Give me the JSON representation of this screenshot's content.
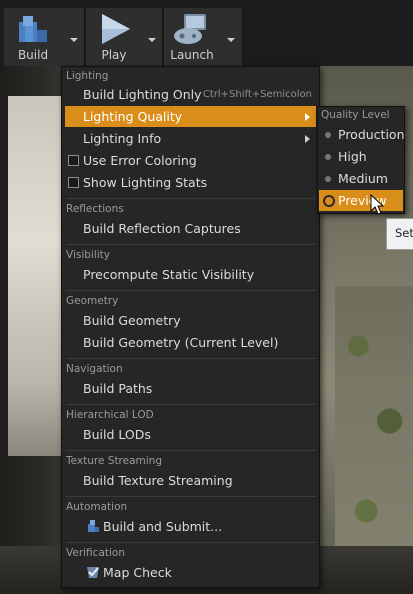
{
  "toolbar": {
    "build_label": "Build",
    "play_label": "Play",
    "launch_label": "Launch"
  },
  "menu": {
    "sections": [
      {
        "header": "Lighting",
        "items": [
          {
            "label": "Build Lighting Only",
            "shortcut": "Ctrl+Shift+Semicolon"
          },
          {
            "label": "Lighting Quality",
            "highlighted": true,
            "submenu": true
          },
          {
            "label": "Lighting Info",
            "submenu": true
          },
          {
            "label": "Use Error Coloring",
            "checkbox": true,
            "checked": false
          },
          {
            "label": "Show Lighting Stats",
            "checkbox": true,
            "checked": false
          }
        ]
      },
      {
        "header": "Reflections",
        "items": [
          {
            "label": "Build Reflection Captures"
          }
        ]
      },
      {
        "header": "Visibility",
        "items": [
          {
            "label": "Precompute Static Visibility"
          }
        ]
      },
      {
        "header": "Geometry",
        "items": [
          {
            "label": "Build Geometry"
          },
          {
            "label": "Build Geometry (Current Level)"
          }
        ]
      },
      {
        "header": "Navigation",
        "items": [
          {
            "label": "Build Paths"
          }
        ]
      },
      {
        "header": "Hierarchical LOD",
        "items": [
          {
            "label": "Build LODs"
          }
        ]
      },
      {
        "header": "Texture Streaming",
        "items": [
          {
            "label": "Build Texture Streaming"
          }
        ]
      },
      {
        "header": "Automation",
        "items": [
          {
            "label": "Build and Submit...",
            "icon": "build-submit-icon"
          }
        ]
      },
      {
        "header": "Verification",
        "items": [
          {
            "label": "Map Check",
            "icon": "map-check-icon"
          }
        ]
      }
    ]
  },
  "submenu": {
    "header": "Quality Level",
    "options": [
      {
        "label": "Production",
        "selected": false
      },
      {
        "label": "High",
        "selected": false
      },
      {
        "label": "Medium",
        "selected": false
      },
      {
        "label": "Preview",
        "selected": true,
        "highlighted": true
      }
    ]
  },
  "tooltip": {
    "text": "Set"
  },
  "colors": {
    "highlight": "#d98e1a",
    "menu_bg": "#262626"
  }
}
